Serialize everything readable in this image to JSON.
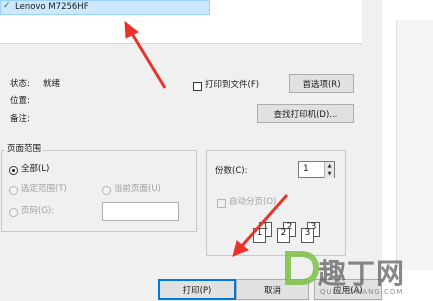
{
  "printer_list": {
    "selected_printer": "Lenovo M7256HF"
  },
  "printer_info": {
    "status_label": "状态:",
    "status_value": "就绪",
    "location_label": "位置:",
    "comment_label": "备注:"
  },
  "print_to_file": {
    "label": "打印到文件(F)",
    "checked": false
  },
  "buttons": {
    "preferences": "首选项(R)",
    "find_printer": "查找打印机(D)...",
    "print": "打印(P)",
    "cancel": "取消",
    "apply": "应用(A)"
  },
  "page_range": {
    "title": "页面范围",
    "all": "全部(L)",
    "selection": "选定范围(T)",
    "current_page": "当前页面(U)",
    "pages": "页码(G):",
    "pages_value": "",
    "selected": "all"
  },
  "copies": {
    "label": "份数(C):",
    "value": "1",
    "collate_label": "自动分页(O)",
    "collate_checked": false,
    "collate_pages": [
      "1",
      "1",
      "2",
      "2",
      "3",
      "3"
    ]
  },
  "watermark": {
    "logo_letter": "D",
    "brand": "趣丁网",
    "url": "QUDINGWANG.COM"
  },
  "icons": {
    "printer_status": "green-check-icon",
    "annotation": "red-arrow-icon"
  },
  "colors": {
    "dialog_bg": "#f0f0f0",
    "selection_bg": "#cce8ff",
    "primary_border": "#0078d7",
    "annotation_arrow": "#e8332b",
    "watermark_logo": "#7ac143"
  }
}
